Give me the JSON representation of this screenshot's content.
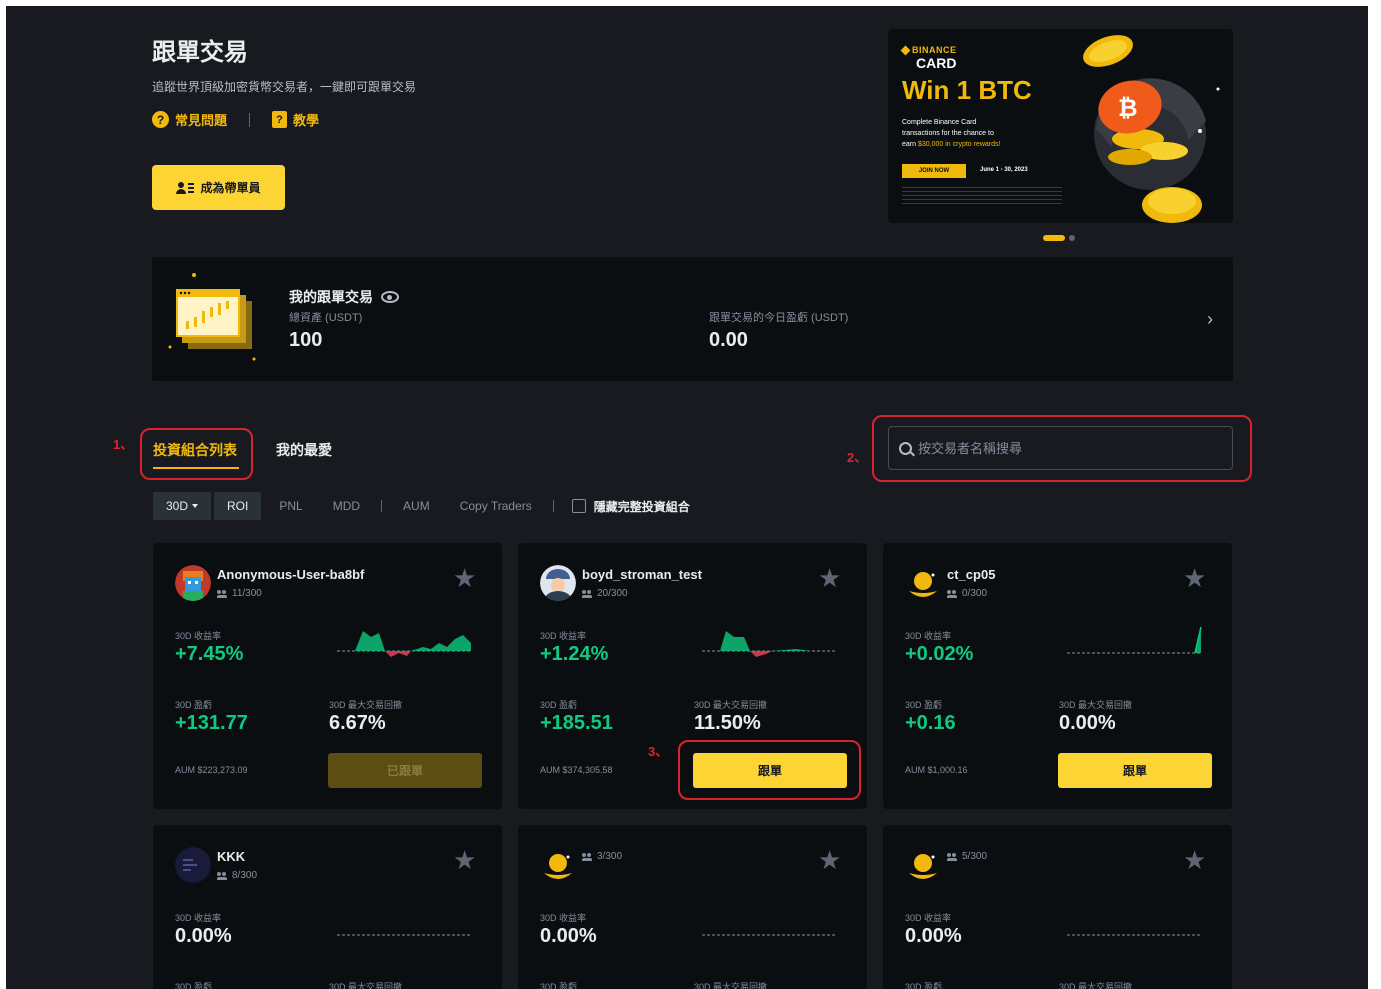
{
  "header": {
    "title": "跟單交易",
    "subtitle": "追蹤世界頂級加密貨幣交易者，一鍵即可跟單交易",
    "faq_label": "常見問題",
    "tutorial_label": "教學",
    "become_lead_label": "成為帶單員"
  },
  "banner": {
    "brand": "BINANCE",
    "card": "CARD",
    "headline": "Win 1 BTC",
    "desc_line1": "Complete Binance Card",
    "desc_line2": "transactions for the chance to",
    "desc_line3a": "earn ",
    "desc_line3b": "$30,000 in crypto rewards!",
    "join_label": "JOIN NOW",
    "date": "June 1 - 30, 2023"
  },
  "my_copy": {
    "title": "我的跟單交易",
    "total_label": "總資產 (USDT)",
    "total_value": "100",
    "today_pnl_label": "跟單交易的今日盈虧 (USDT)",
    "today_pnl_value": "0.00"
  },
  "annotations": {
    "a1": "1、",
    "a2": "2、",
    "a3": "3、"
  },
  "tabs": {
    "portfolio_list": "投資組合列表",
    "favorites": "我的最愛"
  },
  "search": {
    "placeholder": "按交易者名稱搜尋"
  },
  "filters": {
    "period": "30D",
    "roi": "ROI",
    "pnl": "PNL",
    "mdd": "MDD",
    "aum": "AUM",
    "copy_traders": "Copy Traders",
    "hide_full": "隱藏完整投資組合"
  },
  "cards": [
    {
      "name": "Anonymous-User-ba8bf",
      "followers": "11/300",
      "roi_label": "30D 收益率",
      "roi": "+7.45%",
      "pnl_label": "30D 盈虧",
      "pnl": "+131.77",
      "mdd_label": "30D 最大交易回撤",
      "mdd": "6.67%",
      "aum": "AUM $223,273.09",
      "button": "已跟單"
    },
    {
      "name": "boyd_stroman_test",
      "followers": "20/300",
      "roi_label": "30D 收益率",
      "roi": "+1.24%",
      "pnl_label": "30D 盈虧",
      "pnl": "+185.51",
      "mdd_label": "30D 最大交易回撤",
      "mdd": "11.50%",
      "aum": "AUM $374,305.58",
      "button": "跟單"
    },
    {
      "name": "ct_cp05",
      "followers": "0/300",
      "roi_label": "30D 收益率",
      "roi": "+0.02%",
      "pnl_label": "30D 盈虧",
      "pnl": "+0.16",
      "mdd_label": "30D 最大交易回撤",
      "mdd": "0.00%",
      "aum": "AUM $1,000.16",
      "button": "跟單"
    },
    {
      "name": "KKK",
      "followers": "8/300",
      "roi_label": "30D 收益率",
      "roi": "0.00%",
      "pnl_label": "30D 盈虧",
      "mdd_label": "30D 最大交易回撤"
    },
    {
      "name": "",
      "followers": "3/300",
      "roi_label": "30D 收益率",
      "roi": "0.00%",
      "pnl_label": "30D 盈虧",
      "mdd_label": "30D 最大交易回撤"
    },
    {
      "name": "",
      "followers": "5/300",
      "roi_label": "30D 收益率",
      "roi": "0.00%",
      "pnl_label": "30D 盈虧",
      "mdd_label": "30D 最大交易回撤"
    }
  ],
  "colors": {
    "accent": "#f0b90b",
    "button": "#fcd535",
    "positive": "#0ecb81",
    "negative": "#f6465d",
    "annotation": "#d7232f"
  }
}
